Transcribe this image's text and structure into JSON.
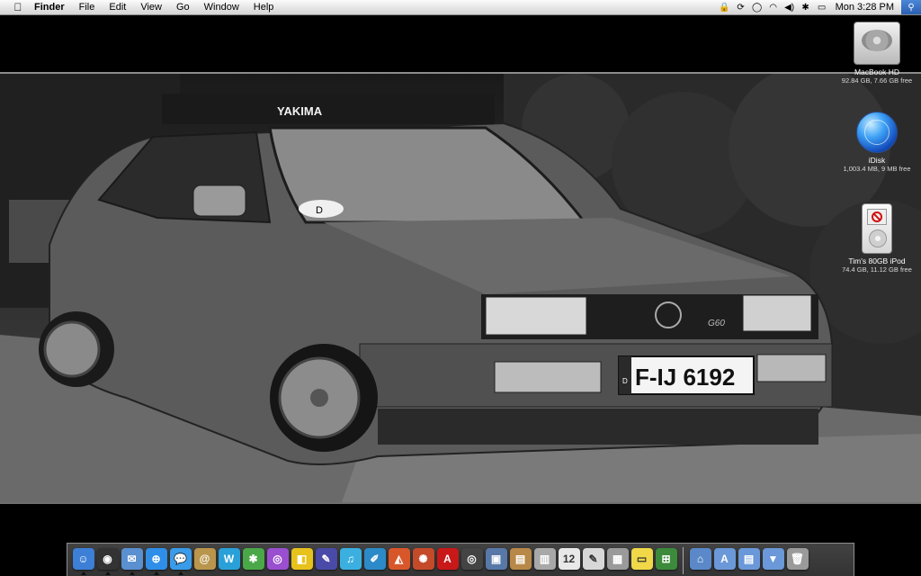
{
  "menubar": {
    "apple_icon": "apple-logo-icon",
    "app_name": "Finder",
    "menus": [
      "File",
      "Edit",
      "View",
      "Go",
      "Window",
      "Help"
    ],
    "status_icons": [
      "lock-icon",
      "sync-icon",
      "ichat-icon",
      "wifi-icon",
      "volume-icon",
      "bluetooth-icon",
      "battery-icon"
    ],
    "clock": "Mon 3:28 PM",
    "spotlight_icon": "spotlight-icon"
  },
  "wallpaper": {
    "roof_rack_text": "YAKIMA",
    "badge": "D",
    "plate_country": "D",
    "plate": "F-IJ 6192",
    "model_badge": "G60"
  },
  "desktop_icons": [
    {
      "name": "MacBook HD",
      "detail": "92.84 GB, 7.66 GB free"
    },
    {
      "name": "iDisk",
      "detail": "1,003.4 MB, 9 MB free"
    },
    {
      "name": "Tim's 80GB iPod",
      "detail": "74.4 GB, 11.12 GB free"
    }
  ],
  "dock": {
    "apps": [
      {
        "icon": "finder-icon",
        "color": "#3d7fd6",
        "glyph": "☺",
        "running": true
      },
      {
        "icon": "dashboard-icon",
        "color": "#333333",
        "glyph": "◉",
        "running": true
      },
      {
        "icon": "mail-icon",
        "color": "#5a8fd0",
        "glyph": "✉",
        "running": true
      },
      {
        "icon": "safari-icon",
        "color": "#2f8ee8",
        "glyph": "⊕",
        "running": true
      },
      {
        "icon": "ichat-icon",
        "color": "#3a9be8",
        "glyph": "💬",
        "running": true
      },
      {
        "icon": "address-book-icon",
        "color": "#b9964c",
        "glyph": "@",
        "running": false
      },
      {
        "icon": "ical-wide-icon",
        "color": "#2aa0d8",
        "glyph": "W",
        "running": false
      },
      {
        "icon": "iweb-icon",
        "color": "#4aa848",
        "glyph": "✱",
        "running": false
      },
      {
        "icon": "ilife-icon",
        "color": "#9a4fd0",
        "glyph": "◎",
        "running": false
      },
      {
        "icon": "sticky-icon",
        "color": "#e8c21c",
        "glyph": "◧",
        "running": false
      },
      {
        "icon": "pen-icon",
        "color": "#4a4aa8",
        "glyph": "✎",
        "running": false
      },
      {
        "icon": "itunes-icon",
        "color": "#3bb0e0",
        "glyph": "♫",
        "running": false
      },
      {
        "icon": "pages-icon",
        "color": "#2c8ac8",
        "glyph": "✐",
        "running": false
      },
      {
        "icon": "keynote-icon",
        "color": "#d8572a",
        "glyph": "◭",
        "running": false
      },
      {
        "icon": "firefox-icon",
        "color": "#c44a2a",
        "glyph": "✺",
        "running": false
      },
      {
        "icon": "acrobat-icon",
        "color": "#c81818",
        "glyph": "A",
        "running": false
      },
      {
        "icon": "camera-icon",
        "color": "#444444",
        "glyph": "◎",
        "running": false
      },
      {
        "icon": "iphoto-icon",
        "color": "#5878a8",
        "glyph": "▣",
        "running": false
      },
      {
        "icon": "preview-icon",
        "color": "#b88848",
        "glyph": "▤",
        "running": false
      },
      {
        "icon": "installer-icon",
        "color": "#a8a8a8",
        "glyph": "▥",
        "running": false
      },
      {
        "icon": "calendar-icon",
        "color": "#e8e8e8",
        "glyph": "12",
        "running": false
      },
      {
        "icon": "textedit-icon",
        "color": "#d8d8d8",
        "glyph": "✎",
        "running": false
      },
      {
        "icon": "calculator-icon",
        "color": "#9a9a9a",
        "glyph": "▦",
        "running": false
      },
      {
        "icon": "stickies-icon",
        "color": "#f0d848",
        "glyph": "▭",
        "running": false
      },
      {
        "icon": "windows-icon",
        "color": "#3c8a3c",
        "glyph": "⊞",
        "running": false
      }
    ],
    "folders": [
      {
        "icon": "home-folder-icon",
        "color": "#5a88c8",
        "glyph": "⌂"
      },
      {
        "icon": "applications-folder-icon",
        "color": "#6a98d8",
        "glyph": "A"
      },
      {
        "icon": "documents-folder-icon",
        "color": "#6a98d8",
        "glyph": "▤"
      },
      {
        "icon": "downloads-folder-icon",
        "color": "#6a98d8",
        "glyph": "▼"
      },
      {
        "icon": "trash-icon",
        "color": "#9a9a9a",
        "glyph": "🗑"
      }
    ]
  }
}
